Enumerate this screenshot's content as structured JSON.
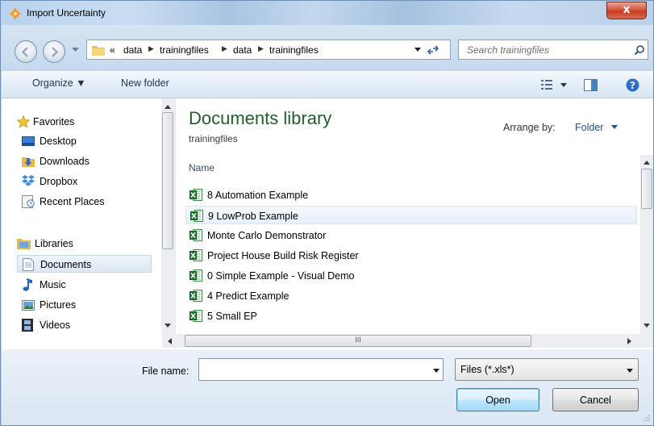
{
  "window": {
    "title": "Import Uncertainty",
    "close_label": "x"
  },
  "address": {
    "overflow": "«",
    "crumbs": [
      "data",
      "trainingfiles",
      "data",
      "trainingfiles"
    ]
  },
  "search": {
    "placeholder": "Search trainingfiles"
  },
  "toolbar": {
    "organize": "Organize ▼",
    "new_folder": "New folder"
  },
  "sidebar": {
    "favorites": {
      "header": "Favorites",
      "items": [
        "Desktop",
        "Downloads",
        "Dropbox",
        "Recent Places"
      ]
    },
    "libraries": {
      "header": "Libraries",
      "items": [
        "Documents",
        "Music",
        "Pictures",
        "Videos"
      ]
    }
  },
  "library": {
    "title": "Documents library",
    "subtitle": "trainingfiles",
    "arrange_label": "Arrange by:",
    "arrange_value": "Folder",
    "column_name": "Name",
    "files": [
      "8 Automation Example",
      "9 LowProb Example",
      "Monte Carlo Demonstrator",
      "Project House Build Risk Register",
      "0 Simple Example - Visual Demo",
      "4 Predict Example",
      "5 Small EP"
    ],
    "selected_index": 1
  },
  "footer": {
    "file_name_label": "File name:",
    "file_name_value": "",
    "file_type": "Files (*.xls*)",
    "open": "Open",
    "cancel": "Cancel"
  },
  "hscroll_mark": "III",
  "colors": {
    "library_title": "#1e5e29",
    "link_blue": "#1f4f9b",
    "selection": "#dde8f4"
  }
}
